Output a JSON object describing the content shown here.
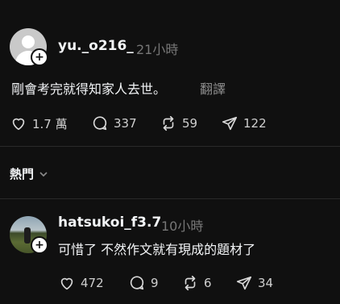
{
  "post": {
    "username": "yu._o216_",
    "time": "21小時",
    "content": "剛會考完就得知家人去世。",
    "translate": "翻譯",
    "likes": "1.7 萬",
    "comments": "337",
    "reposts": "59",
    "shares": "122"
  },
  "sort_label": "熱門",
  "reply": {
    "username": "hatsukoi_f3.7",
    "time": "10小時",
    "content": "可惜了 不然作文就有現成的題材了",
    "likes": "472",
    "comments": "9",
    "reposts": "6",
    "shares": "34"
  }
}
